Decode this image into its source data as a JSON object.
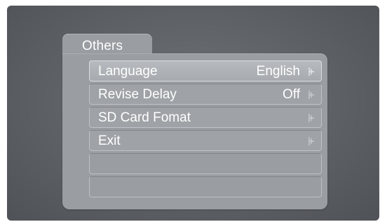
{
  "menu": {
    "title": "Others",
    "items": [
      {
        "label": "Language",
        "value": "English",
        "icon": "chevron-right-icon",
        "selected": true
      },
      {
        "label": "Revise Delay",
        "value": "Off",
        "icon": "chevron-right-icon",
        "selected": false
      },
      {
        "label": "SD Card Fomat",
        "value": "",
        "icon": "chevron-right-icon",
        "selected": false
      },
      {
        "label": "Exit",
        "value": "",
        "icon": "chevron-right-icon",
        "selected": false
      }
    ],
    "empty_rows": 2
  },
  "colors": {
    "screen_bg": "#5d6065",
    "panel_bg": "#9a9da1",
    "selected_row_bg": "#b7babe",
    "text": "#ffffff"
  }
}
